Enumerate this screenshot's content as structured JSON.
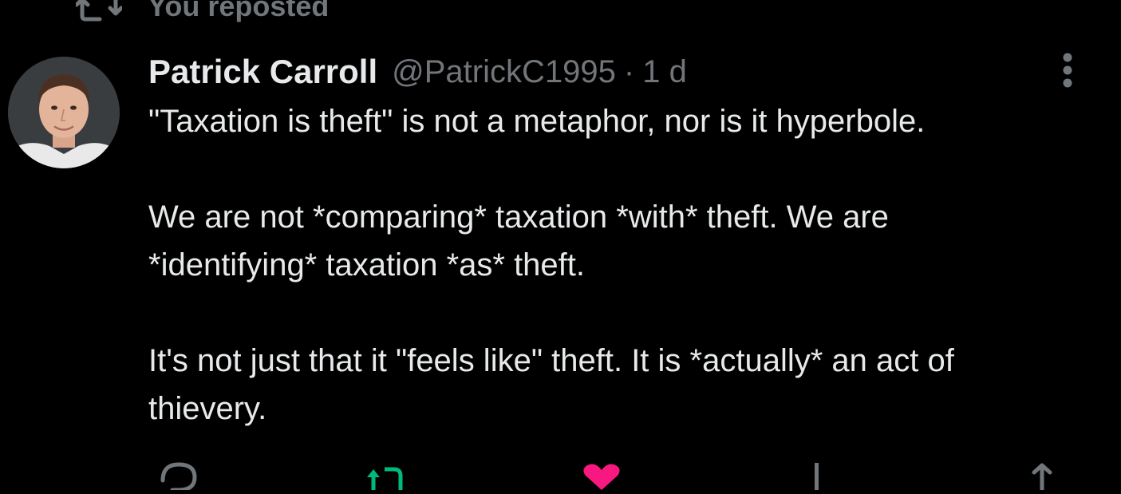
{
  "repost_banner": {
    "icon": "repost-icon",
    "text": "You reposted"
  },
  "tweet": {
    "author": {
      "display_name": "Patrick Carroll",
      "handle": "@PatrickC1995",
      "avatar_icon": "avatar"
    },
    "separator": "·",
    "timestamp": "1 d",
    "more_icon": "more-vertical-icon",
    "body": {
      "line1": "\"Taxation is theft\" is not a metaphor, nor is it hyperbole.",
      "line2": "We are not *comparing* taxation *with* theft. We are",
      "line3": "*identifying* taxation *as* theft.",
      "line4": "It's not just that it \"feels like\" theft. It is *actually* an act of",
      "line5": "thievery."
    }
  },
  "actions": [
    {
      "icon": "reply-icon",
      "color": "#71767b"
    },
    {
      "icon": "retweet-icon",
      "color": "#00ba7c"
    },
    {
      "icon": "like-icon",
      "color": "#f91880"
    },
    {
      "icon": "views-icon",
      "color": "#71767b"
    },
    {
      "icon": "share-icon",
      "color": "#71767b"
    }
  ],
  "colors": {
    "background": "#000000",
    "text_primary": "#e7e9ea",
    "text_secondary": "#71767b",
    "retweet_green": "#00ba7c",
    "like_pink": "#f91880"
  }
}
